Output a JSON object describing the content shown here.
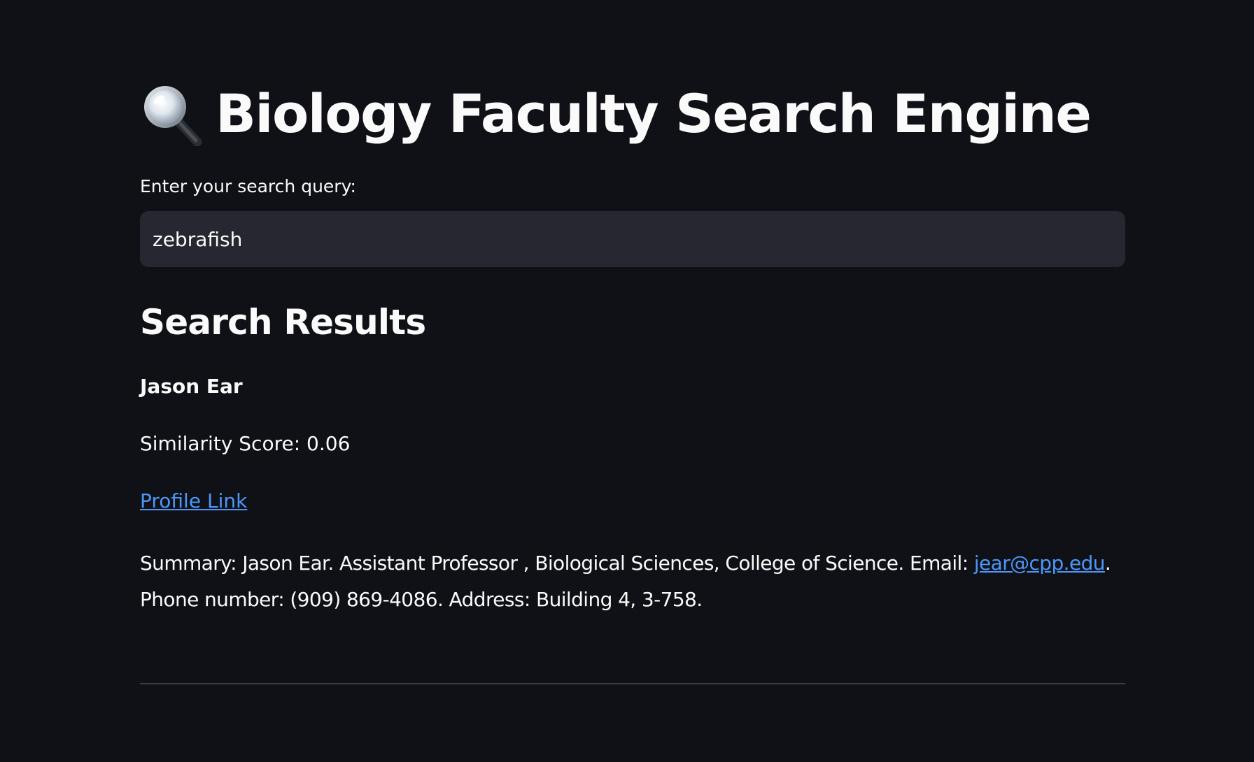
{
  "header": {
    "title": "Biology Faculty Search Engine",
    "icon": "magnifying-glass-icon"
  },
  "search": {
    "label": "Enter your search query:",
    "value": "zebrafish"
  },
  "results": {
    "heading": "Search Results",
    "items": [
      {
        "name": "Jason Ear",
        "score_text": "Similarity Score: 0.06",
        "profile_link_label": "Profile Link",
        "summary_before_email": "Summary: Jason Ear. Assistant Professor , Biological Sciences, College of Science. Email: ",
        "email": "jear@cpp.edu",
        "summary_after_email": ". Phone number: (909) 869-4086. Address: Building 4, 3-758."
      }
    ]
  },
  "colors": {
    "background": "#0f1117",
    "input_background": "#262730",
    "link": "#4d96f6",
    "text": "#fafafa"
  }
}
